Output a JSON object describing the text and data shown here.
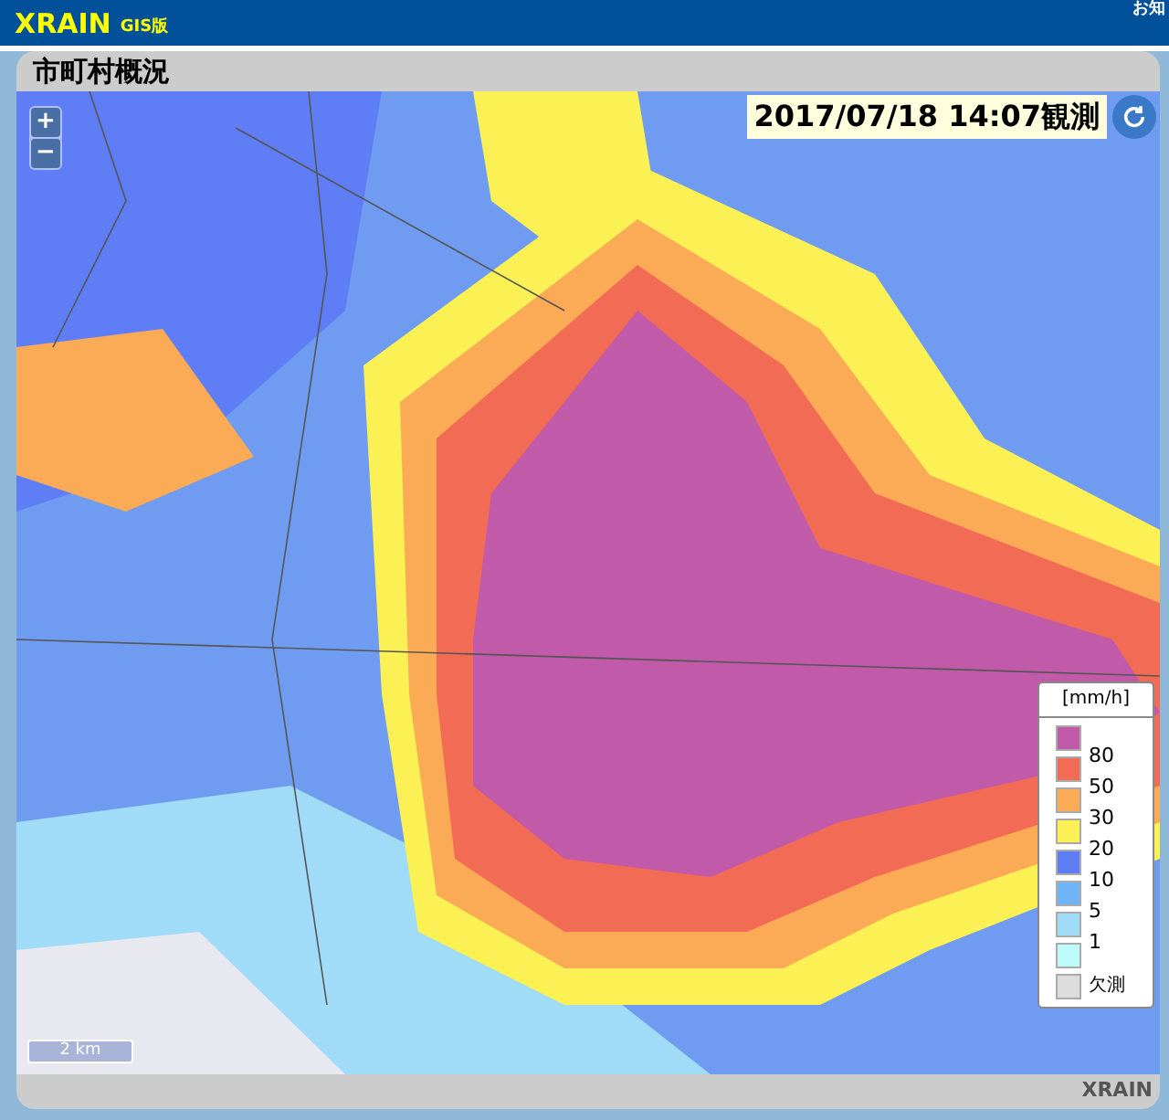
{
  "header": {
    "logo": "XRAIN",
    "logo_suffix": "GIS版",
    "link": "お知"
  },
  "panel": {
    "title": "市町村概況",
    "footer": "XRAIN"
  },
  "map": {
    "zoom_in": "+",
    "zoom_out": "−",
    "timestamp": "2017/07/18 14:07観測",
    "scale": "2 km"
  },
  "legend": {
    "unit": "[mm/h]",
    "swatches": [
      {
        "color": "#c15aa8"
      },
      {
        "color": "#f26b55"
      },
      {
        "color": "#fbab55"
      },
      {
        "color": "#fbf155"
      },
      {
        "color": "#5f7ef5"
      },
      {
        "color": "#70b4f8"
      },
      {
        "color": "#a0dcf8"
      },
      {
        "color": "#bdfbfb"
      }
    ],
    "labels": [
      "80",
      "50",
      "30",
      "20",
      "10",
      "5",
      "1"
    ],
    "missing": {
      "color": "#dcdcdc",
      "label": "欠測"
    }
  }
}
